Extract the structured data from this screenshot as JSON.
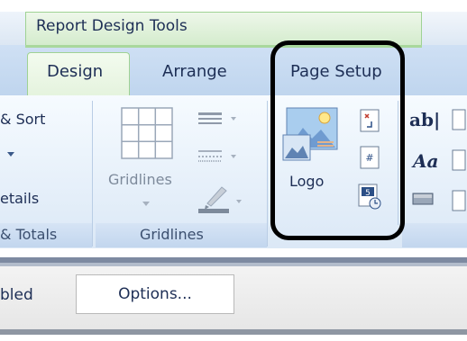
{
  "ribbon": {
    "context_title": "Report Design Tools",
    "tabs": [
      {
        "label": "Design",
        "active": true
      },
      {
        "label": "Arrange",
        "active": false
      },
      {
        "label": "Page Setup",
        "active": false
      }
    ]
  },
  "groups": {
    "grouping": {
      "sort_label": "& Sort",
      "details_label": "etails",
      "footer_label": "& Totals"
    },
    "gridlines": {
      "button_label": "Gridlines",
      "footer_label": "Gridlines"
    },
    "controls": {
      "logo_label": "Logo",
      "text_box_label": "ab|",
      "label_glyph": "Aa"
    }
  },
  "lower_bar": {
    "enabled_text": "bled",
    "options_label": "Options..."
  },
  "colors": {
    "context_tab_green": "#d4eccd",
    "ribbon_blue": "#bfd5ee",
    "text_navy": "#1d2e55",
    "highlight": "#000000"
  }
}
